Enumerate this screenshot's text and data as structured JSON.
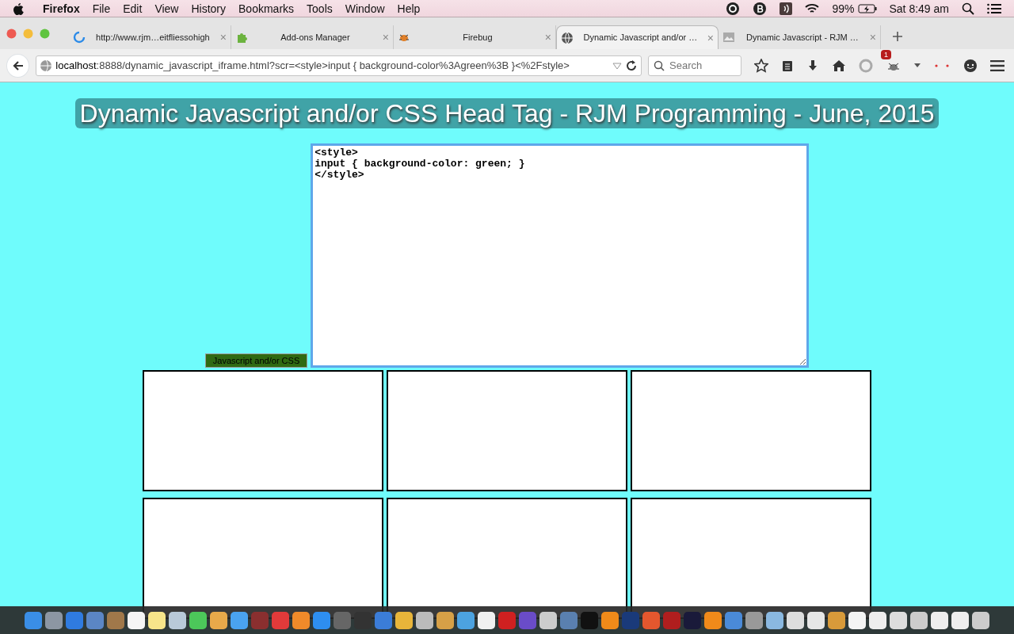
{
  "menu_bar": {
    "app": "Firefox",
    "menus": [
      "File",
      "Edit",
      "View",
      "History",
      "Bookmarks",
      "Tools",
      "Window",
      "Help"
    ],
    "battery": "99%",
    "clock": "Sat 8:49 am"
  },
  "tabs": [
    {
      "title": "http://www.rjm…eitfliessohigh",
      "selected": false,
      "kind": "loading",
      "close": "×"
    },
    {
      "title": "Add-ons Manager",
      "selected": false,
      "kind": "puzzle",
      "close": "×"
    },
    {
      "title": "Firebug",
      "selected": false,
      "kind": "bug",
      "close": "×"
    },
    {
      "title": "Dynamic Javascript and/or …",
      "selected": true,
      "kind": "globe",
      "close": "×"
    },
    {
      "title": "Dynamic Javascript - RJM …",
      "selected": false,
      "kind": "image",
      "close": "×"
    }
  ],
  "address_bar": {
    "host": "localhost",
    "rest": ":8888/dynamic_javascript_iframe.html?scr=<style>input { background-color%3Agreen%3B }<%2Fstyle>"
  },
  "search": {
    "placeholder": "Search"
  },
  "toolbar": {
    "badge": "1"
  },
  "page": {
    "heading": "Dynamic Javascript and/or CSS Head Tag - RJM Programming - June, 2015",
    "editor": {
      "value": "<style>\ninput { background-color: green; }\n</style>\n",
      "focused": true
    },
    "button": "Javascript and/or CSS"
  }
}
